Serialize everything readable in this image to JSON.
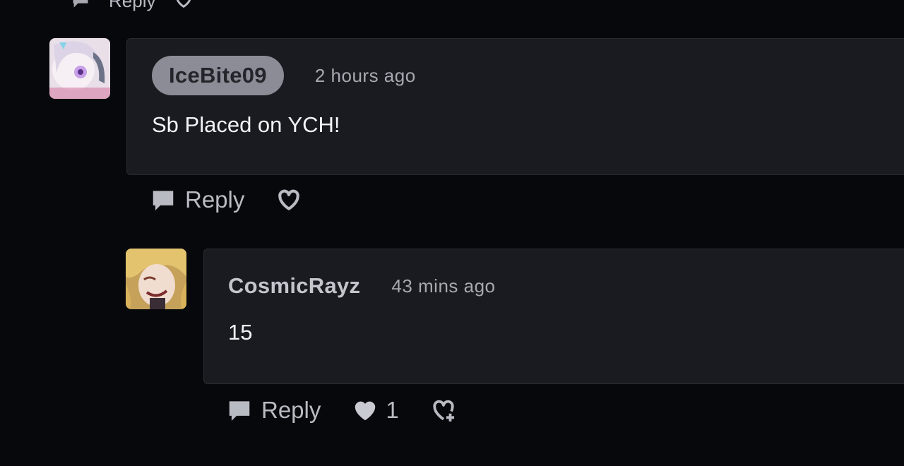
{
  "top_remnant": {
    "reply_label": "Reply"
  },
  "comments": [
    {
      "username": "IceBite09",
      "timestamp": "2 hours ago",
      "text": "Sb Placed on YCH!",
      "reply_label": "Reply",
      "like_count": ""
    },
    {
      "username": "CosmicRayz",
      "timestamp": "43 mins ago",
      "text": "15",
      "reply_label": "Reply",
      "like_count": "1"
    }
  ],
  "icons": {
    "reply": "speech-bubble-icon",
    "like": "heart-icon",
    "react": "heart-plus-icon"
  },
  "colors": {
    "background": "#07080c",
    "card": "#1a1b20",
    "pill": "#8b8c95",
    "muted_text": "#a7a9b1"
  }
}
